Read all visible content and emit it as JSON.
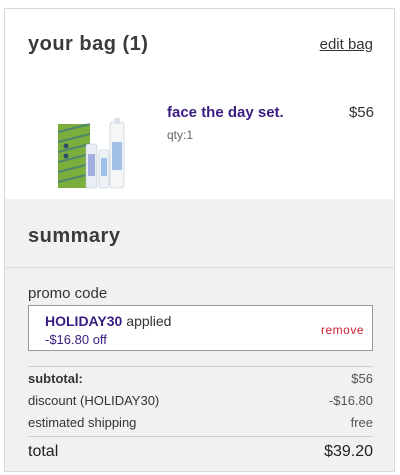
{
  "bag": {
    "title": "your bag (1)",
    "edit_label": "edit bag"
  },
  "item": {
    "name": "face the day set.",
    "price": "$56",
    "qty": "qty:1",
    "image": "product-set-image",
    "colors": {
      "box": "#7cae3e",
      "box_stripes": "#2f6b8f",
      "tube": "#e8eef4"
    }
  },
  "summary": {
    "title": "summary",
    "promo_label": "promo code",
    "promo": {
      "code": "HOLIDAY30",
      "status": "applied",
      "discount": "-$16.80 off",
      "remove_label": "remove"
    },
    "lines": [
      {
        "label": "subtotal:",
        "value": "$56"
      },
      {
        "label": "discount (HOLIDAY30)",
        "value": "-$16.80"
      },
      {
        "label": "estimated shipping",
        "value": "free"
      }
    ],
    "total_label": "total",
    "total_value": "$39.20"
  },
  "colors": {
    "accent": "#3a1d82",
    "remove": "#c81f2e",
    "summary_bg": "#f1f1f1"
  }
}
